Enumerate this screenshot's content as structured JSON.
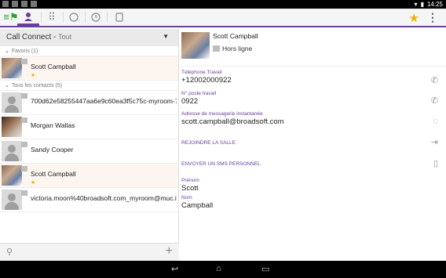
{
  "statusbar": {
    "time": "14:25"
  },
  "topbar": {
    "tabs": [
      "dialpad",
      "contacts",
      "chat",
      "history",
      "voicemail"
    ]
  },
  "left": {
    "header_title": "Call Connect",
    "header_sub": "Tout",
    "sections": {
      "favorites": "Favoris (1)",
      "contacts": "Tous les contacts (5)"
    },
    "favorites": [
      {
        "name": "Scott Campball",
        "presence": "★"
      }
    ],
    "contacts": [
      {
        "name": "700d62e58255447aa6e9c60ea3f5c75c-myroom-7..."
      },
      {
        "name": "Morgan Wallas"
      },
      {
        "name": "Sandy Cooper"
      },
      {
        "name": "Scott Campball",
        "presence": "★"
      },
      {
        "name": "victoria.moon%40broadsoft.com_myroom@muc.ih..."
      }
    ]
  },
  "detail": {
    "name": "Scott Campball",
    "status": "Hors ligne",
    "work_phone_label": "Téléphone Travail",
    "work_phone": "+12002000922",
    "extension_label": "N° poste travail",
    "extension": "0922",
    "im_label": "Adresse de messagerie instantanée",
    "im": "scott.campball@broadsoft.com",
    "join_room": "REJOINDRE LA SALLE",
    "send_sms": "ENVOYER UN SMS PERSONNEL",
    "first_name_label": "Prénom",
    "first_name": "Scott",
    "last_name_label": "Nom",
    "last_name": "Campball"
  },
  "colors": {
    "accent": "#6a3e9b",
    "star": "#f2b100"
  }
}
